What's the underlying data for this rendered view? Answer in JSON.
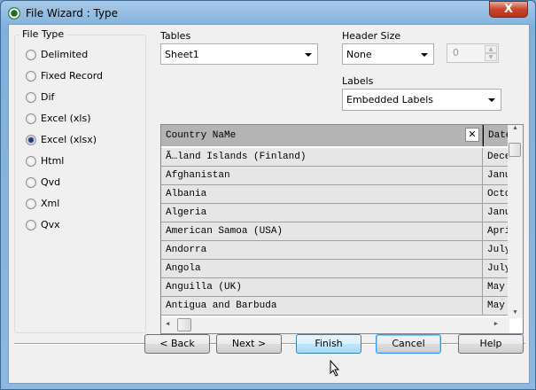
{
  "window": {
    "title": "File Wizard : Type",
    "close_label": "X"
  },
  "file_type": {
    "label": "File Type",
    "options": [
      {
        "label": "Delimited",
        "selected": false
      },
      {
        "label": "Fixed Record",
        "selected": false
      },
      {
        "label": "Dif",
        "selected": false
      },
      {
        "label": "Excel (xls)",
        "selected": false
      },
      {
        "label": "Excel (xlsx)",
        "selected": true
      },
      {
        "label": "Html",
        "selected": false
      },
      {
        "label": "Qvd",
        "selected": false
      },
      {
        "label": "Xml",
        "selected": false
      },
      {
        "label": "Qvx",
        "selected": false
      }
    ]
  },
  "tables": {
    "label": "Tables",
    "value": "Sheet1"
  },
  "header_size": {
    "label": "Header Size",
    "value": "None",
    "spin_value": "0"
  },
  "labels": {
    "label": "Labels",
    "value": "Embedded Labels"
  },
  "grid": {
    "columns": [
      "Country NaMe",
      "Date"
    ],
    "remove_column_label": "✕",
    "rows": [
      [
        "Ã…land Islands (Finland)",
        "Dece"
      ],
      [
        "Afghanistan",
        "Janu"
      ],
      [
        "Albania",
        "Octo"
      ],
      [
        "Algeria",
        "Janu"
      ],
      [
        "American Samoa (USA)",
        "Apri"
      ],
      [
        "Andorra",
        "July"
      ],
      [
        "Angola",
        "July"
      ],
      [
        "Anguilla (UK)",
        "May"
      ],
      [
        "Antigua and Barbuda",
        "May"
      ]
    ]
  },
  "buttons": {
    "back": "< Back",
    "next": "Next >",
    "finish": "Finish",
    "cancel": "Cancel",
    "help": "Help"
  }
}
